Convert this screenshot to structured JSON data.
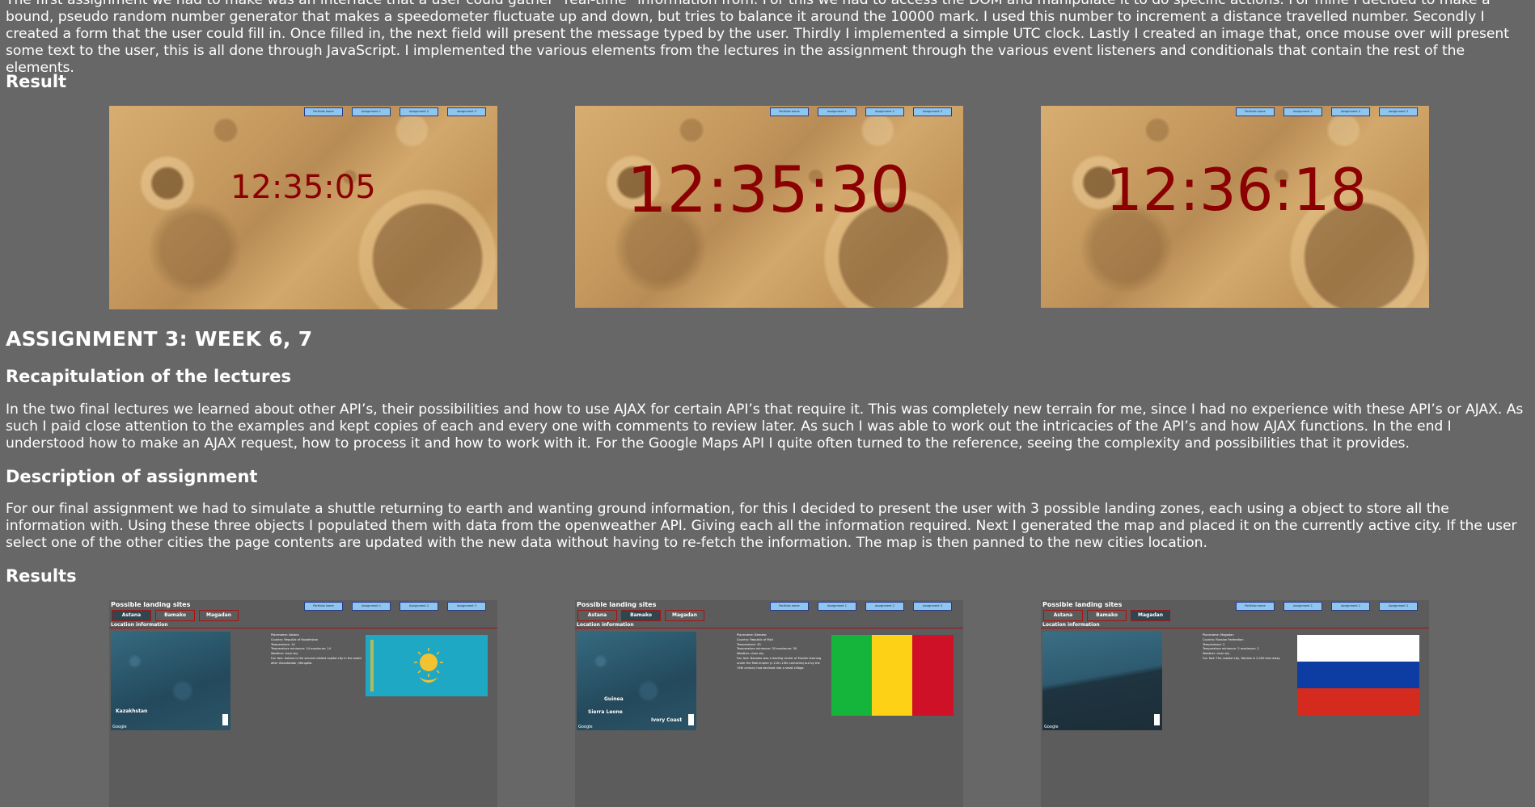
{
  "assignment2": {
    "intro_text": "The first assignment we had to make was an interface that a user could gather \"real-time\" information from. For this we had to access the DOM and manipulate it to do specific actions. For mine I decided to make a bound, pseudo random number generator that makes a speedometer fluctuate up and down, but tries to balance it around the 10000 mark. I used this number to increment a distance travelled number. Secondly I created a form that the user could fill in. Once filled in, the next field will present the message typed by the user. Thirdly I implemented a simple UTC clock. Lastly I created an image that, once mouse over will present some text to the user, this is all done through JavaScript. I implemented the various elements from the lectures in the assignment through the various event listeners and conditionals that contain the rest of the elements.",
    "result_heading": "Result",
    "screenshots": [
      {
        "time": "12:35:05"
      },
      {
        "time": "12:35:30"
      },
      {
        "time": "12:36:18"
      }
    ]
  },
  "nav_buttons": [
    "Portfolio home",
    "Assignment 1",
    "Assignment 2",
    "Assignment 3"
  ],
  "assignment3": {
    "title": "ASSIGNMENT 3: WEEK 6, 7",
    "recap_heading": "Recapitulation of the lectures",
    "recap_text": "In the two final lectures we learned about other API’s, their possibilities and how to use AJAX for certain API’s that require it. This was completely new terrain for me, since I had no experience with these API’s or AJAX. As such I paid close attention to the examples and kept copies of each and every one with comments to review later. As such I was able to work out the intricacies of the API’s and how AJAX functions. In the end I understood how to make an AJAX request, how to process it and how to work with it. For the Google Maps API I quite often turned to the reference, seeing the complexity and possibilities that it provides.",
    "desc_heading": "Description of assignment",
    "desc_text": "For our final assignment we had to simulate a shuttle returning to earth and wanting ground information, for this I decided to present the user with 3 possible landing zones, each using a object to store all the information with. Using these three objects I populated them with data from the openweather API. Giving each all the information required. Next I generated the map and placed it on the currently active city. If the user select one of the other cities the page contents are updated with the new data without having to re-fetch the information. The map is then panned to the new cities location.",
    "results_heading": "Results",
    "app": {
      "title": "Possible landing sites",
      "location_title": "Location information",
      "cities": [
        "Astana",
        "Bamako",
        "Magadan"
      ],
      "google": "Google"
    },
    "screens": [
      {
        "active": 0,
        "info": [
          "Placename: Astana",
          "Country: Republic of Kazakhstan",
          "Temperature: 14",
          "Temperature minimum: 14 maximum: 14",
          "Weather: clear sky",
          "Fun fact: Astana is the second coldest capital city in the world after Ulaanbaatar, Mongolia."
        ],
        "map_labels": [
          "Kazakhstan"
        ]
      },
      {
        "active": 1,
        "info": [
          "Placename: Bamako",
          "Country: Republic of Mali",
          "Temperature: 30",
          "Temperature minimum: 30 maximum: 30",
          "Weather: clear sky",
          "Fun fact: Bamako was a leading center of Muslim learning under the Mali empire (c.11th–15th centuries) but by the 19th century had declined into a small village."
        ],
        "map_labels": [
          "Guinea",
          "Sierra Leone",
          "Ivory Coast"
        ]
      },
      {
        "active": 2,
        "info": [
          "Placename: Magadan",
          "Country: Russian Federation",
          "Temperature: 2",
          "Temperature minimum: 2 maximum: 2",
          "Weather: clear sky",
          "Fun fact: The coastal city, Yakutsk is 2,000 kms away."
        ],
        "map_labels": []
      }
    ]
  },
  "colors": {
    "background": "#676767",
    "clock": "#8b0000",
    "nav_button": "#8fc6ee",
    "city_border": "#aa1111",
    "kz_flag": "#1fa8c4",
    "kz_sun": "#f2c230",
    "mali_green": "#14b53a",
    "mali_yellow": "#fcd116",
    "mali_red": "#ce1126",
    "ru_white": "#ffffff",
    "ru_blue": "#0d3da3",
    "ru_red": "#d52b1e"
  }
}
